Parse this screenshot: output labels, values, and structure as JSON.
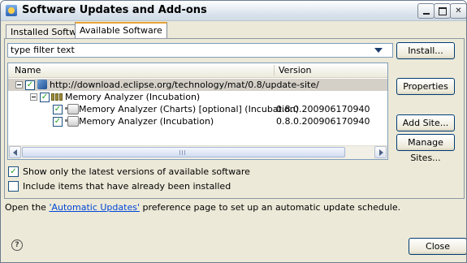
{
  "window": {
    "title": "Software Updates and Add-ons"
  },
  "tabs": [
    {
      "label": "Installed Software",
      "active": false
    },
    {
      "label": "Available Software",
      "active": true
    }
  ],
  "filter": {
    "placeholder": "type filter text",
    "value": "type filter text"
  },
  "table": {
    "columns": {
      "name": "Name",
      "version": "Version"
    },
    "rows": [
      {
        "label": "http://download.eclipse.org/technology/mat/0.8/update-site/",
        "version": "",
        "checked": true,
        "icon": "update-site-icon"
      },
      {
        "label": "Memory Analyzer (Incubation)",
        "version": "",
        "checked": true,
        "icon": "feature-group-icon"
      },
      {
        "label": "Memory Analyzer (Charts) [optional] (Incubation)",
        "version": "0.8.0.200906170940",
        "checked": true,
        "icon": "plugin-icon"
      },
      {
        "label": "Memory Analyzer (Incubation)",
        "version": "0.8.0.200906170940",
        "checked": true,
        "icon": "plugin-icon"
      }
    ]
  },
  "buttons": {
    "install": "Install...",
    "properties": "Properties",
    "add_site": "Add Site...",
    "manage_sites": "Manage Sites...",
    "close": "Close"
  },
  "options": {
    "latest_only": {
      "label": "Show only the latest versions of available software",
      "checked": true
    },
    "include_installed": {
      "label": "Include items that have already been installed",
      "checked": false
    }
  },
  "footer": {
    "prefix": "Open the ",
    "link": "'Automatic Updates'",
    "suffix": " preference page to set up an automatic update schedule."
  }
}
